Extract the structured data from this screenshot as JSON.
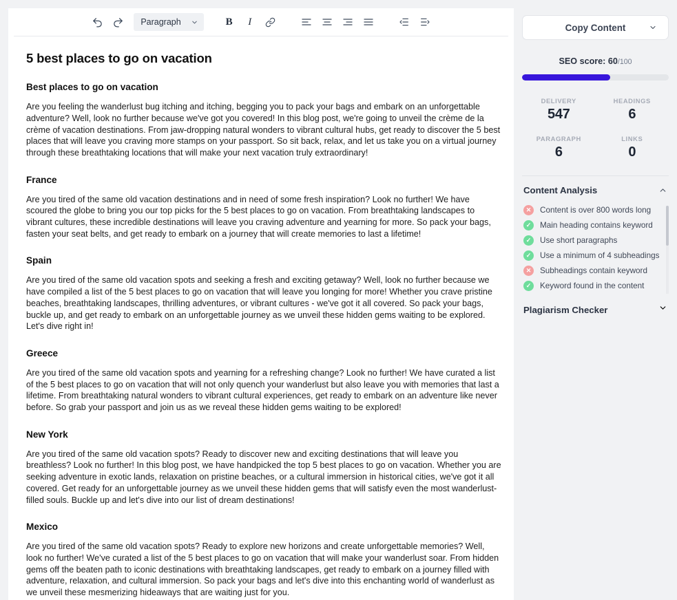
{
  "toolbar": {
    "undo_icon": "undo-icon",
    "redo_icon": "redo-icon",
    "block_format": "Paragraph",
    "bold_label": "B",
    "italic_label": "I",
    "link_icon": "link-icon",
    "align_left_icon": "align-left-icon",
    "align_center_icon": "align-center-icon",
    "align_right_icon": "align-right-icon",
    "align_justify_icon": "align-justify-icon",
    "outdent_icon": "outdent-icon",
    "indent_icon": "indent-icon"
  },
  "document": {
    "title": "5 best places to go on vacation",
    "sections": [
      {
        "heading": "Best places to go on vacation",
        "paragraph": "Are you feeling the wanderlust bug itching and itching, begging you to pack your bags and embark on an unforgettable adventure? Well, look no further because we've got you covered! In this blog post, we're going to unveil the crème de la crème of vacation destinations. From jaw-dropping natural wonders to vibrant cultural hubs, get ready to discover the 5 best places that will leave you craving more stamps on your passport. So sit back, relax, and let us take you on a virtual journey through these breathtaking locations that will make your next vacation truly extraordinary!"
      },
      {
        "heading": "France",
        "paragraph": "Are you tired of the same old vacation destinations and in need of some fresh inspiration? Look no further! We have scoured the globe to bring you our top picks for the 5 best places to go on vacation. From breathtaking landscapes to vibrant cultures, these incredible destinations will leave you craving adventure and yearning for more. So pack your bags, fasten your seat belts, and get ready to embark on a journey that will create memories to last a lifetime!"
      },
      {
        "heading": "Spain",
        "paragraph": "Are you tired of the same old vacation spots and seeking a fresh and exciting getaway? Well, look no further because we have compiled a list of the 5 best places to go on vacation that will leave you longing for more! Whether you crave pristine beaches, breathtaking landscapes, thrilling adventures, or vibrant cultures - we've got it all covered. So pack your bags, buckle up, and get ready to embark on an unforgettable journey as we unveil these hidden gems waiting to be explored. Let's dive right in!"
      },
      {
        "heading": "Greece",
        "paragraph": "Are you tired of the same old vacation spots and yearning for a refreshing change? Look no further! We have curated a list of the 5 best places to go on vacation that will not only quench your wanderlust but also leave you with memories that last a lifetime. From breathtaking natural wonders to vibrant cultural experiences, get ready to embark on an adventure like never before. So grab your passport and join us as we reveal these hidden gems waiting to be explored!"
      },
      {
        "heading": "New York",
        "paragraph": "Are you tired of the same old vacation spots? Ready to discover new and exciting destinations that will leave you breathless? Look no further! In this blog post, we have handpicked the top 5 best places to go on vacation. Whether you are seeking adventure in exotic lands, relaxation on pristine beaches, or a cultural immersion in historical cities, we've got it all covered. Get ready for an unforgettable journey as we unveil these hidden gems that will satisfy even the most wanderlust-filled souls. Buckle up and let's dive into our list of dream destinations!"
      },
      {
        "heading": "Mexico",
        "paragraph": "Are you tired of the same old vacation spots? Ready to explore new horizons and create unforgettable memories? Well, look no further! We've curated a list of the 5 best places to go on vacation that will make your wanderlust soar. From hidden gems off the beaten path to iconic destinations with breathtaking landscapes, get ready to embark on a journey filled with adventure, relaxation, and cultural immersion. So pack your bags and let's dive into this enchanting world of wanderlust as we unveil these mesmerizing hideaways that are waiting just for you."
      }
    ]
  },
  "sidebar": {
    "copy_button": "Copy Content",
    "copy_chevron_icon": "chevron-down-icon",
    "seo_score_label": "SEO score: ",
    "seo_score_value": "60",
    "seo_score_denominator": "/100",
    "seo_progress_percent": 60,
    "progress_color": "#3716db",
    "metrics": [
      {
        "label": "DELIVERY",
        "value": "547"
      },
      {
        "label": "HEADINGS",
        "value": "6"
      },
      {
        "label": "PARAGRAPH",
        "value": "6"
      },
      {
        "label": "LINKS",
        "value": "0"
      }
    ],
    "content_analysis": {
      "title": "Content Analysis",
      "chevron_icon": "chevron-up-icon",
      "expanded": true,
      "pass_color": "#6fdd9c",
      "fail_color": "#f5a0a0",
      "items": [
        {
          "text": "Content is over 800 words long",
          "status": "fail"
        },
        {
          "text": "Main heading contains keyword",
          "status": "pass"
        },
        {
          "text": "Use short paragraphs",
          "status": "pass"
        },
        {
          "text": "Use a minimum of 4 subheadings",
          "status": "pass"
        },
        {
          "text": "Subheadings contain keyword",
          "status": "fail"
        },
        {
          "text": "Keyword found in the content",
          "status": "pass"
        }
      ]
    },
    "plagiarism_checker": {
      "title": "Plagiarism Checker",
      "chevron_icon": "chevron-down-icon",
      "expanded": false
    }
  }
}
